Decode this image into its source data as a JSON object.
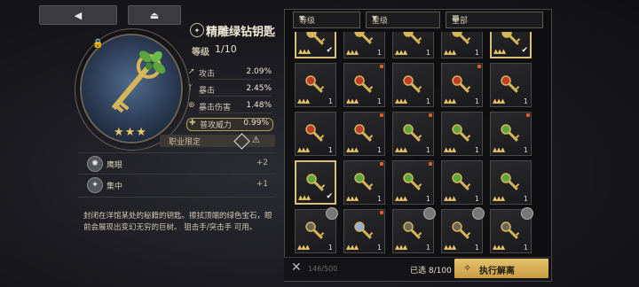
{
  "nav": {
    "back_icon": "back-arrow-icon",
    "collapse_icon": "eject-icon"
  },
  "item": {
    "name": "精雕绿钻钥匙",
    "level_label": "等级",
    "level_value": "1/10",
    "stars": "★★★",
    "stats": [
      {
        "icon": "arrow-icon",
        "label": "攻击",
        "value": "2.09%"
      },
      {
        "icon": "crit-icon",
        "label": "暴击",
        "value": "2.45%"
      },
      {
        "icon": "crit-dmg-icon",
        "label": "暴击伤害",
        "value": "1.48%"
      },
      {
        "icon": "power-icon",
        "label": "普攻威力",
        "value": "0.99%"
      }
    ],
    "job_label": "职业限定",
    "skills": [
      {
        "icon": "eagle-eye-icon",
        "name": "鹰眼",
        "bonus": "+2"
      },
      {
        "icon": "focus-icon",
        "name": "集中",
        "bonus": "+1"
      }
    ],
    "description": "封闭在洋馆某处的秘籍的钥匙。擦拭顶端的绿色宝石，眼前会展现出变幻无穷的巨树。 狙击手/突击手 可用。"
  },
  "filters": {
    "level": "等级",
    "star": "星级",
    "all": "全部"
  },
  "grid_cells": [
    {
      "gem": "gold",
      "num": "",
      "check": true,
      "sel": true
    },
    {
      "gem": "gold",
      "num": "1"
    },
    {
      "gem": "gold",
      "num": "1"
    },
    {
      "gem": "gold",
      "num": "1"
    },
    {
      "gem": "gold",
      "num": "",
      "check": true,
      "sel": true
    },
    {
      "gem": "red",
      "num": "1"
    },
    {
      "gem": "red",
      "num": "1",
      "dot": true
    },
    {
      "gem": "red",
      "num": "1"
    },
    {
      "gem": "red",
      "num": "1",
      "dot": true
    },
    {
      "gem": "red",
      "num": "1"
    },
    {
      "gem": "red",
      "num": "1"
    },
    {
      "gem": "red",
      "num": "1",
      "dot": true
    },
    {
      "gem": "green",
      "num": "1",
      "dot": true
    },
    {
      "gem": "green",
      "num": "1"
    },
    {
      "gem": "green",
      "num": "1",
      "dot": true
    },
    {
      "gem": "green",
      "num": "",
      "check": true,
      "sel": true
    },
    {
      "gem": "green",
      "num": "1",
      "dot": true
    },
    {
      "gem": "green",
      "num": "1",
      "dot": true
    },
    {
      "gem": "green",
      "num": "1"
    },
    {
      "gem": "green",
      "num": "1"
    },
    {
      "gem": "dark",
      "num": "1",
      "pin": true
    },
    {
      "gem": "blue",
      "num": "1",
      "dot": true
    },
    {
      "gem": "dark",
      "num": "1",
      "pin": true
    },
    {
      "gem": "dark",
      "num": "1",
      "pin": true
    },
    {
      "gem": "dark",
      "num": "1",
      "pin": true
    }
  ],
  "bottom": {
    "capacity": "146/500",
    "selected": "已选 8/100",
    "execute": "执行解离"
  },
  "colors": {
    "accent": "#d8c07a",
    "gold": "#e8c46a"
  }
}
